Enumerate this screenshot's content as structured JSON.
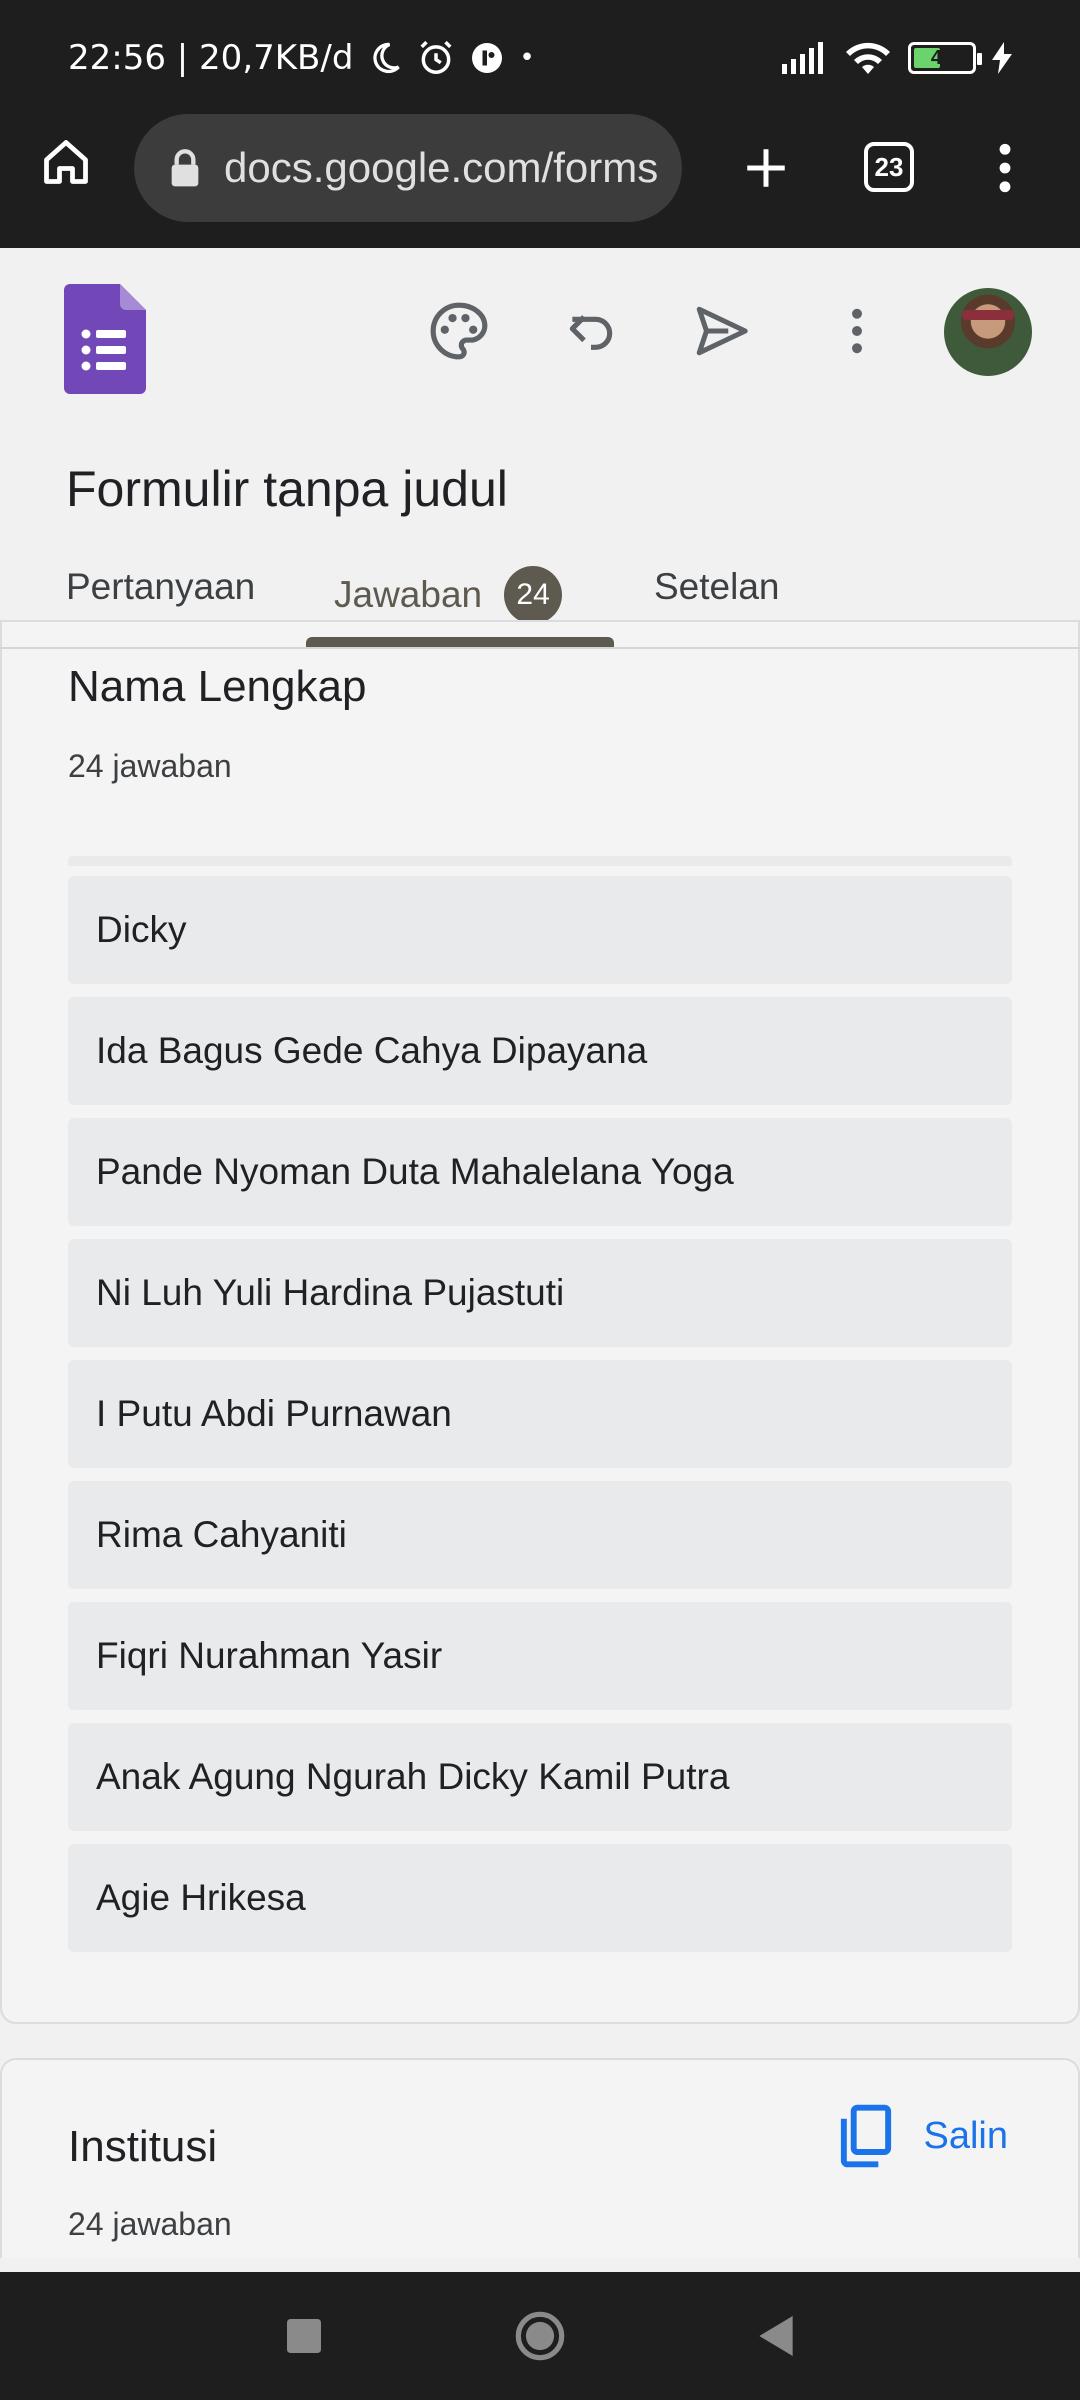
{
  "status_bar": {
    "time_speed": "22:56 | 20,7KB/d",
    "battery_level": "46",
    "battery_fill": 0.46
  },
  "browser": {
    "url": "docs.google.com/forms",
    "tab_count": "23"
  },
  "form": {
    "title": "Formulir tanpa judul",
    "tabs": [
      {
        "label": "Pertanyaan"
      },
      {
        "label": "Jawaban",
        "badge": "24"
      },
      {
        "label": "Setelan"
      }
    ]
  },
  "questions": [
    {
      "title": "Nama Lengkap",
      "count": "24 jawaban",
      "responses": [
        "Dicky",
        "Ida Bagus Gede Cahya Dipayana",
        "Pande Nyoman Duta Mahalelana Yoga",
        "Ni Luh Yuli Hardina Pujastuti",
        "I Putu Abdi Purnawan",
        "Rima Cahyaniti",
        "Fiqri Nurahman Yasir",
        "Anak Agung Ngurah Dicky Kamil Putra",
        "Agie Hrikesa"
      ]
    },
    {
      "title": "Institusi",
      "count": "24 jawaban",
      "copy_label": "Salin"
    }
  ],
  "colors": {
    "forms_purple": "#7248b9",
    "accent_blue": "#1a73e8",
    "tab_active": "#5f5a50"
  }
}
